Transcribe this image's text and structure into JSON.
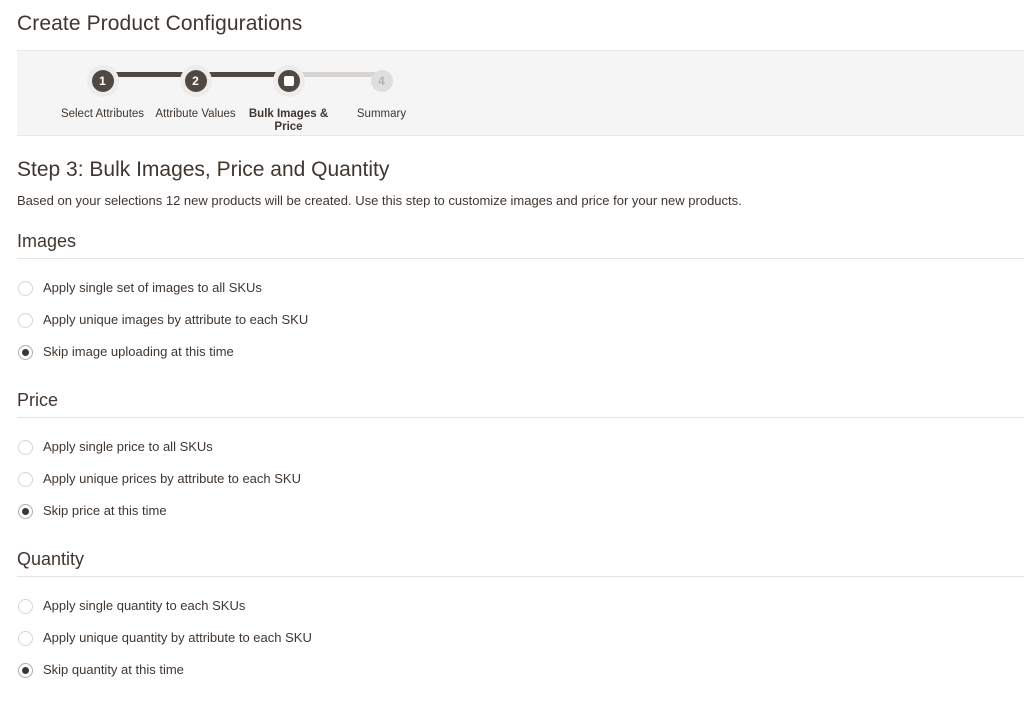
{
  "page": {
    "title": "Create Product Configurations"
  },
  "wizard": {
    "steps": [
      {
        "number": "1",
        "label": "Select Attributes",
        "state": "done"
      },
      {
        "number": "2",
        "label": "Attribute Values",
        "state": "done"
      },
      {
        "number": "3",
        "label": "Bulk Images & Price",
        "state": "active"
      },
      {
        "number": "4",
        "label": "Summary",
        "state": "upcoming"
      }
    ]
  },
  "main": {
    "heading": "Step 3: Bulk Images, Price and Quantity",
    "description": "Based on your selections 12 new products will be created. Use this step to customize images and price for your new products.",
    "product_count": "12",
    "sections": [
      {
        "title": "Images",
        "options": [
          {
            "label": "Apply single set of images to all SKUs",
            "selected": false
          },
          {
            "label": "Apply unique images by attribute to each SKU",
            "selected": false
          },
          {
            "label": "Skip image uploading at this time",
            "selected": true
          }
        ]
      },
      {
        "title": "Price",
        "options": [
          {
            "label": "Apply single price to all SKUs",
            "selected": false
          },
          {
            "label": "Apply unique prices by attribute to each SKU",
            "selected": false
          },
          {
            "label": "Skip price at this time",
            "selected": true
          }
        ]
      },
      {
        "title": "Quantity",
        "options": [
          {
            "label": "Apply single quantity to each SKUs",
            "selected": false
          },
          {
            "label": "Apply unique quantity by attribute to each SKU",
            "selected": false
          },
          {
            "label": "Skip quantity at this time",
            "selected": true
          }
        ]
      }
    ]
  },
  "colors": {
    "text": "#41362f",
    "step_active": "#504943",
    "step_inactive": "#dedede",
    "panel_bg": "#f5f5f5",
    "rule": "#e3e3e3",
    "radio_selected": "#3c3732"
  }
}
